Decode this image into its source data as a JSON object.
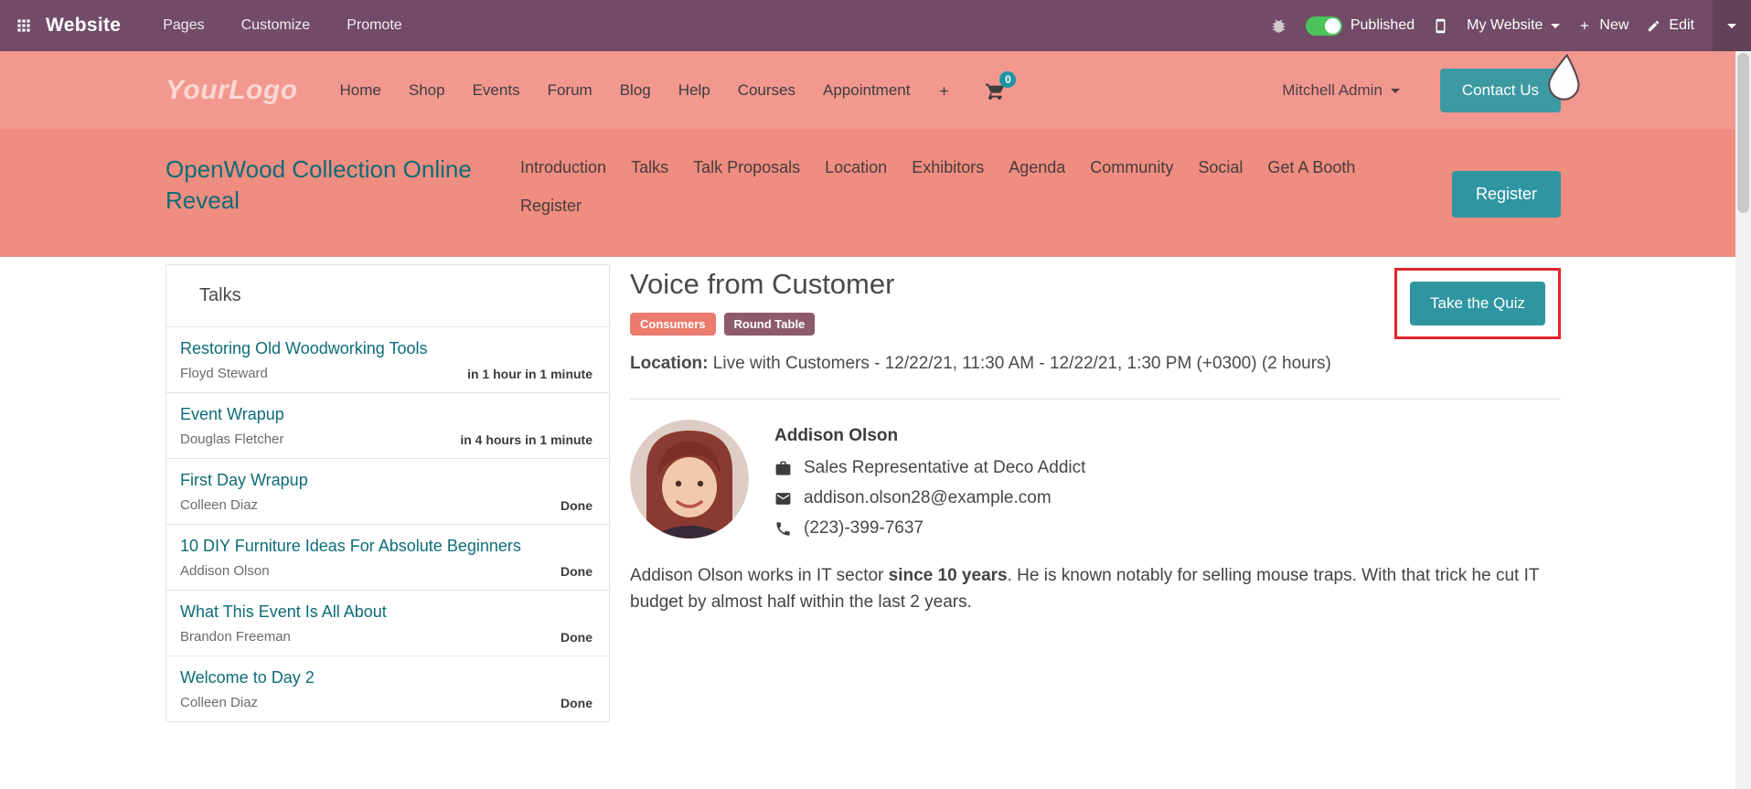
{
  "colors": {
    "topbar_bg": "#714b67",
    "nav_bar_bg": "#f2988f",
    "event_header_bg": "#ef8d80",
    "accent_teal": "#2f96a1",
    "link_teal": "#0d6c77",
    "tag_consumers_bg": "#eb7b6e",
    "tag_round_table_bg": "#8d5a6e",
    "highlight_red": "#e5242b",
    "published_green": "#4cc35a"
  },
  "topbar": {
    "brand": "Website",
    "menus": [
      "Pages",
      "Customize",
      "Promote"
    ],
    "published_label": "Published",
    "website_selector_label": "My Website",
    "new_button_label": "New",
    "edit_button_label": "Edit"
  },
  "site_nav": {
    "logo_text": "YourLogo",
    "items": [
      "Home",
      "Shop",
      "Events",
      "Forum",
      "Blog",
      "Help",
      "Courses",
      "Appointment"
    ],
    "cart_count": "0",
    "user_name": "Mitchell Admin",
    "contact_button": "Contact Us"
  },
  "event_header": {
    "title": "OpenWood Collection Online Reveal",
    "items": [
      "Introduction",
      "Talks",
      "Talk Proposals",
      "Location",
      "Exhibitors",
      "Agenda",
      "Community",
      "Social",
      "Get A Booth",
      "Register"
    ],
    "register_button": "Register"
  },
  "sidebar": {
    "title": "Talks",
    "talks": [
      {
        "title": "Restoring Old Woodworking Tools",
        "speaker": "Floyd Steward",
        "status": "in 1 hour in 1 minute"
      },
      {
        "title": "Event Wrapup",
        "speaker": "Douglas Fletcher",
        "status": "in 4 hours in 1 minute"
      },
      {
        "title": "First Day Wrapup",
        "speaker": "Colleen Diaz",
        "status": "Done"
      },
      {
        "title": "10 DIY Furniture Ideas For Absolute Beginners",
        "speaker": "Addison Olson",
        "status": "Done"
      },
      {
        "title": "What This Event Is All About",
        "speaker": "Brandon Freeman",
        "status": "Done"
      },
      {
        "title": "Welcome to Day 2",
        "speaker": "Colleen Diaz",
        "status": "Done"
      }
    ]
  },
  "talk": {
    "title": "Voice from Customer",
    "tags": [
      {
        "label": "Consumers"
      },
      {
        "label": "Round Table"
      }
    ],
    "quiz_button": "Take the Quiz",
    "location_label": "Location:",
    "location_value": "Live with Customers - 12/22/21, 11:30 AM - 12/22/21, 1:30 PM (+0300) (2 hours)",
    "speaker": {
      "name": "Addison Olson",
      "role": "Sales Representative at Deco Addict",
      "email": "addison.olson28@example.com",
      "phone": "(223)-399-7637",
      "bio_part1": "Addison Olson works in IT sector ",
      "bio_bold": "since 10 years",
      "bio_part2": ". He is known notably for selling mouse traps. With that trick he cut IT budget by almost half within the last 2 years."
    }
  }
}
